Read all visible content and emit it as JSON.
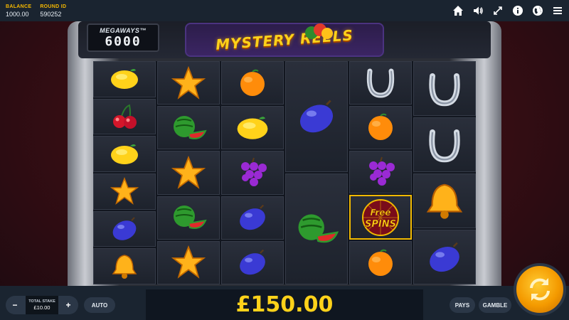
{
  "header": {
    "balance_label": "BALANCE",
    "balance_value": "1000.00",
    "round_label": "ROUND ID",
    "round_value": "590252",
    "icons": [
      "home-icon",
      "volume-icon",
      "fullscreen-icon",
      "info-icon",
      "globe-icon",
      "menu-icon"
    ]
  },
  "game": {
    "megaways_logo": "MEGAWAYS™",
    "megaways_count": "6000",
    "title": "MYSTERY REELS"
  },
  "reels": [
    [
      "lemon",
      "cherry",
      "lemon",
      "star",
      "plum",
      "bell"
    ],
    [
      "star",
      "watermelon",
      "star",
      "watermelon",
      "star"
    ],
    [
      "orange",
      "lemon",
      "grapes",
      "plum",
      "plum"
    ],
    [
      "plum",
      "watermelon"
    ],
    [
      "horseshoe",
      "orange",
      "grapes",
      "free-spins",
      "orange"
    ],
    [
      "horseshoe",
      "horseshoe",
      "bell",
      "plum"
    ]
  ],
  "free_spins_text_1": "Free",
  "free_spins_text_2": "SPINS",
  "footer": {
    "minus": "−",
    "plus": "+",
    "stake_label": "TOTAL STAKE",
    "stake_value": "£10.00",
    "auto_label": "AUTO",
    "win_amount": "£150.00",
    "pays_label": "PAYS",
    "gamble_label": "GAMBLE"
  },
  "colors": {
    "accent": "#ffd21a",
    "bar": "#1a2430",
    "spin": "#f49a00"
  }
}
